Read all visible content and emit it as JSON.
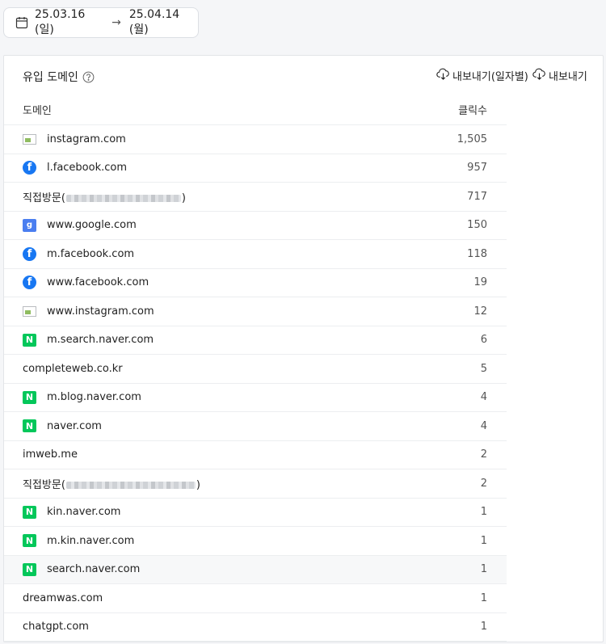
{
  "date_range": {
    "start": "25.03.16 (일)",
    "arrow": "→",
    "end": "25.04.14 (월)"
  },
  "card": {
    "title": "유입 도메인",
    "export_daily": "내보내기(일자별)",
    "export_all": "내보내기"
  },
  "table": {
    "columns": [
      "도메인",
      "클릭수"
    ],
    "rows": [
      {
        "domain": "instagram.com",
        "clicks": "1,505",
        "icon": "broken-image-icon"
      },
      {
        "domain": "l.facebook.com",
        "clicks": "957",
        "icon": "facebook-icon"
      },
      {
        "domain": "직접방문(",
        "suffix": ")",
        "clicks": "717",
        "icon": "none",
        "redacted": true
      },
      {
        "domain": "www.google.com",
        "clicks": "150",
        "icon": "google-icon"
      },
      {
        "domain": "m.facebook.com",
        "clicks": "118",
        "icon": "facebook-icon"
      },
      {
        "domain": "www.facebook.com",
        "clicks": "19",
        "icon": "facebook-icon"
      },
      {
        "domain": "www.instagram.com",
        "clicks": "12",
        "icon": "broken-image-icon"
      },
      {
        "domain": "m.search.naver.com",
        "clicks": "6",
        "icon": "naver-icon"
      },
      {
        "domain": "completeweb.co.kr",
        "clicks": "5",
        "icon": "none"
      },
      {
        "domain": "m.blog.naver.com",
        "clicks": "4",
        "icon": "naver-icon"
      },
      {
        "domain": "naver.com",
        "clicks": "4",
        "icon": "naver-icon"
      },
      {
        "domain": "imweb.me",
        "clicks": "2",
        "icon": "none"
      },
      {
        "domain": "직접방문(",
        "suffix": ")",
        "clicks": "2",
        "icon": "none",
        "redacted": true
      },
      {
        "domain": "kin.naver.com",
        "clicks": "1",
        "icon": "naver-icon"
      },
      {
        "domain": "m.kin.naver.com",
        "clicks": "1",
        "icon": "naver-icon"
      },
      {
        "domain": "search.naver.com",
        "clicks": "1",
        "icon": "naver-icon",
        "highlighted": true
      },
      {
        "domain": "dreamwas.com",
        "clicks": "1",
        "icon": "none"
      },
      {
        "domain": "chatgpt.com",
        "clicks": "1",
        "icon": "none"
      }
    ]
  },
  "colors": {
    "facebook": "#1877f2",
    "naver": "#03c75a",
    "google": "#4a7ef0",
    "border": "#eceef0"
  }
}
